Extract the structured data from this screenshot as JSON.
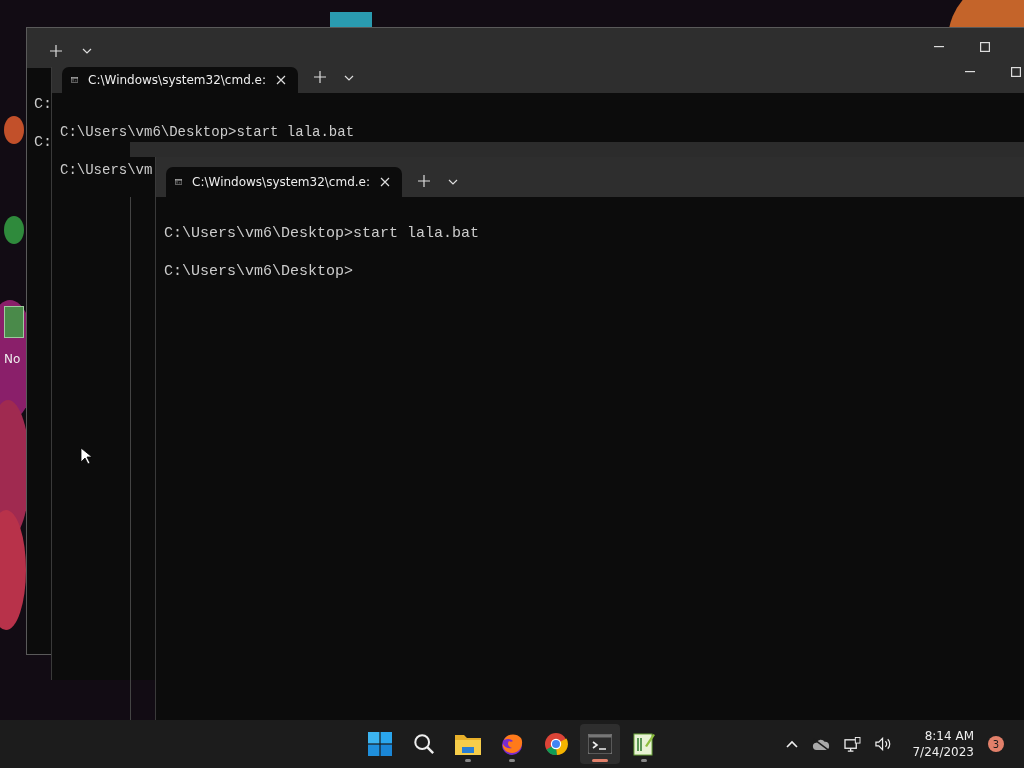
{
  "desktop": {
    "icon_labels": [
      "No"
    ]
  },
  "windows": [
    {
      "kind": "frame",
      "caption_buttons": true,
      "lines": [
        "C:",
        "C:"
      ]
    },
    {
      "kind": "tabbed",
      "caption_buttons": true,
      "tab": {
        "title": "C:\\Windows\\system32\\cmd.e:",
        "selected": true
      },
      "lines": [
        "C:\\Users\\vm6\\Desktop>start lala.bat",
        "C:\\Users\\vm"
      ]
    },
    {
      "kind": "ghost"
    },
    {
      "kind": "tabbed",
      "caption_buttons": false,
      "tab": {
        "title": "C:\\Windows\\system32\\cmd.e:",
        "selected": true
      },
      "lines": [
        "C:\\Users\\vm6\\Desktop>start lala.bat",
        "C:\\Users\\vm6\\Desktop>"
      ]
    }
  ],
  "taskbar": {
    "apps": [
      {
        "kind": "start",
        "running": false,
        "active": false
      },
      {
        "kind": "search",
        "running": false,
        "active": false
      },
      {
        "kind": "files",
        "running": true,
        "active": false
      },
      {
        "kind": "browser_a",
        "running": true,
        "active": false
      },
      {
        "kind": "browser_b",
        "running": false,
        "active": false
      },
      {
        "kind": "terminal",
        "running": true,
        "active": true
      },
      {
        "kind": "editor",
        "running": true,
        "active": false
      }
    ],
    "clock": {
      "time": "8:14 AM",
      "date": "7/24/2023"
    },
    "notification_count": "3"
  }
}
